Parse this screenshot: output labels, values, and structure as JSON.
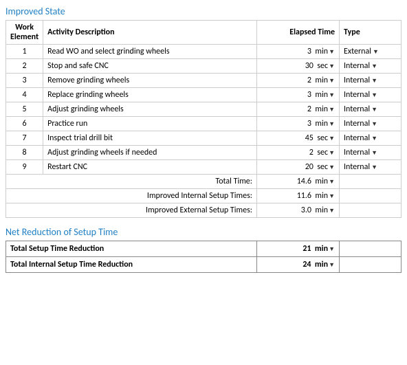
{
  "improvedState": {
    "title": "Improved State",
    "table": {
      "headers": {
        "workElement": "Work\nElement",
        "activityDescription": "Activity Description",
        "elapsedTime": "Elapsed Time",
        "type": "Type"
      },
      "rows": [
        {
          "id": 1,
          "activity": "Read WO and select grinding wheels",
          "value": "3",
          "unit": "min",
          "type": "External"
        },
        {
          "id": 2,
          "activity": "Stop and safe CNC",
          "value": "30",
          "unit": "sec",
          "type": "Internal"
        },
        {
          "id": 3,
          "activity": "Remove grinding wheels",
          "value": "2",
          "unit": "min",
          "type": "Internal"
        },
        {
          "id": 4,
          "activity": "Replace grinding wheels",
          "value": "3",
          "unit": "min",
          "type": "Internal"
        },
        {
          "id": 5,
          "activity": "Adjust grinding wheels",
          "value": "2",
          "unit": "min",
          "type": "Internal"
        },
        {
          "id": 6,
          "activity": "Practice run",
          "value": "3",
          "unit": "min",
          "type": "Internal"
        },
        {
          "id": 7,
          "activity": "Inspect trial drill bit",
          "value": "45",
          "unit": "sec",
          "type": "Internal"
        },
        {
          "id": 8,
          "activity": "Adjust grinding wheels if needed",
          "value": "2",
          "unit": "sec",
          "type": "Internal"
        },
        {
          "id": 9,
          "activity": "Restart CNC",
          "value": "20",
          "unit": "sec",
          "type": "Internal"
        }
      ],
      "summary": [
        {
          "label": "Total Time:",
          "value": "14.6",
          "unit": "min"
        },
        {
          "label": "Improved Internal Setup Times:",
          "value": "11.6",
          "unit": "min"
        },
        {
          "label": "Improved External Setup Times:",
          "value": "3.0",
          "unit": "min"
        }
      ]
    }
  },
  "netReduction": {
    "title": "Net Reduction of Setup Time",
    "rows": [
      {
        "label": "Total Setup Time Reduction",
        "value": "21",
        "unit": "min"
      },
      {
        "label": "Total Internal Setup Time Reduction",
        "value": "24",
        "unit": "min"
      }
    ]
  }
}
